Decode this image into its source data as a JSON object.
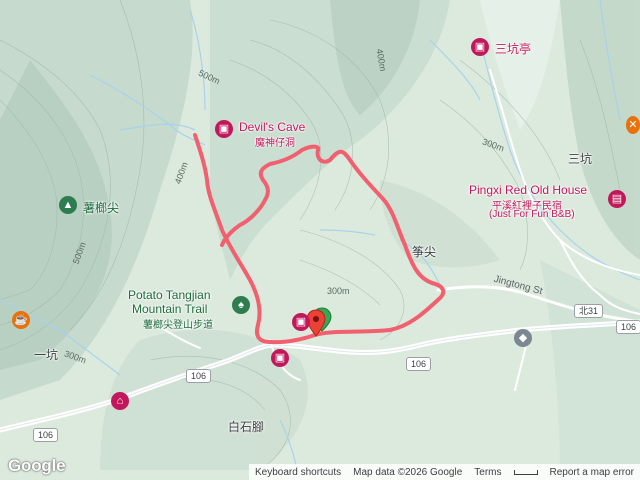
{
  "map": {
    "colors": {
      "terrain_light": "#e9f3ec",
      "terrain_dark": "#b9d1c4",
      "route": "#f25f6e",
      "road": "#ffffff",
      "river": "#b3d7ee",
      "poi_pink": "#c2185b",
      "poi_green": "#2e7d4f"
    },
    "pois": {
      "devils_cave_en": "Devil's Cave",
      "devils_cave_zh": "魔神仔洞",
      "sankeng_pavilion": "三坑亭",
      "pingxi_en": "Pingxi Red Old House",
      "pingxi_zh1": "平溪紅裡子民宿",
      "pingxi_zh2": "(Just For Fun B&B)",
      "potato_en1": "Potato Tangjian",
      "potato_en2": "Mountain Trail",
      "potato_zh": "薯榔尖登山步道",
      "shulangjian": "薯榔尖"
    },
    "places": {
      "sankeng": "三坑",
      "zhengjian": "筝尖",
      "yikeng": "一坑",
      "baishijiao": "白石腳"
    },
    "roads": {
      "jingtong_st": "Jingtong St",
      "r106": "106",
      "north31": "北31"
    },
    "contours": {
      "c500a": "500m",
      "c500b": "500m",
      "c400a": "400m",
      "c400b": "400m",
      "c300a": "300m",
      "c300b": "300m",
      "c300c": "300m"
    },
    "attribution": {
      "logo": "Google",
      "shortcuts": "Keyboard shortcuts",
      "data": "Map data ©2026 Google",
      "terms": "Terms",
      "report": "Report a map error"
    }
  }
}
